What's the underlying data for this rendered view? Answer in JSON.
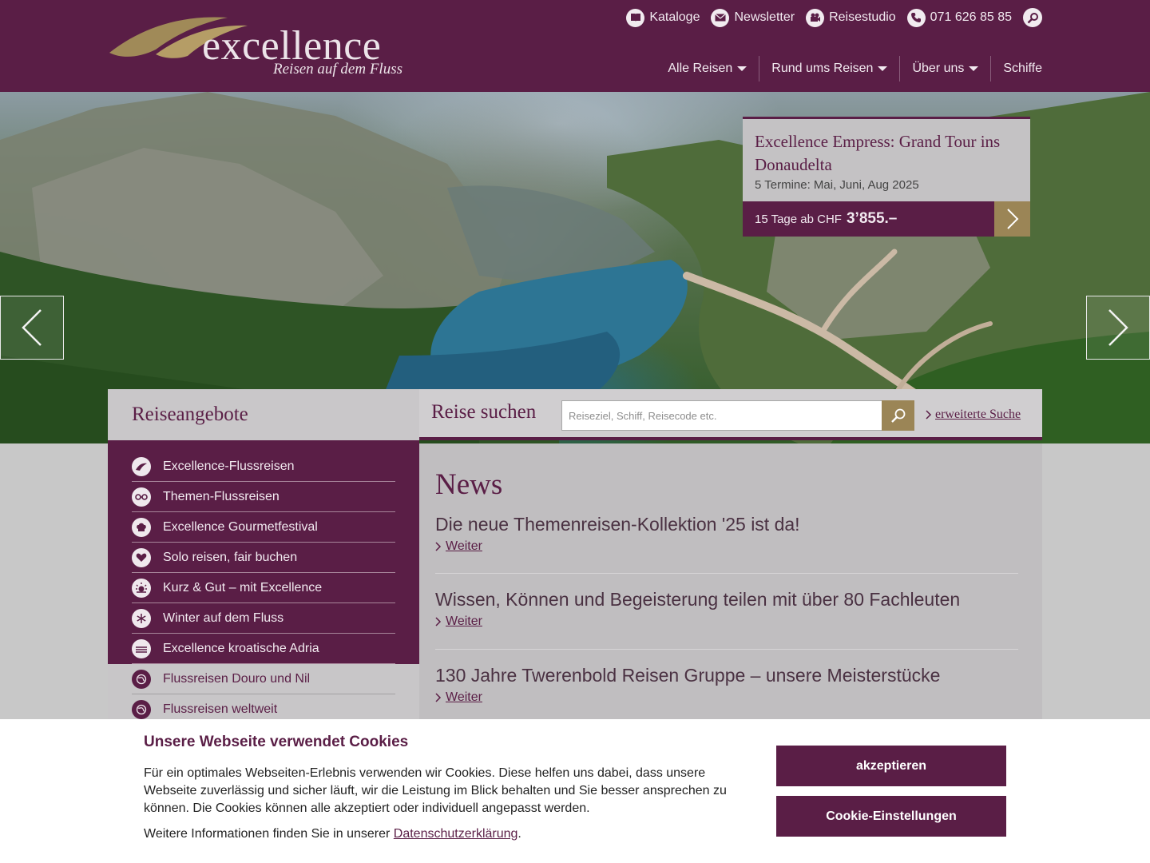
{
  "header": {
    "logo_word": "excellence",
    "logo_tagline": "Reisen auf dem Fluss",
    "topbar": [
      {
        "label": "Kataloge",
        "icon": "book-icon"
      },
      {
        "label": "Newsletter",
        "icon": "envelope-icon"
      },
      {
        "label": "Reisestudio",
        "icon": "camera-icon"
      },
      {
        "label": "071 626 85 85",
        "icon": "phone-icon"
      }
    ],
    "nav": [
      {
        "label": "Alle Reisen",
        "dropdown": true
      },
      {
        "label": "Rund ums Reisen",
        "dropdown": true
      },
      {
        "label": "Über uns",
        "dropdown": true
      },
      {
        "label": "Schiffe",
        "dropdown": false
      }
    ]
  },
  "hero": {
    "promo_title": "Excellence Empress: Grand Tour ins Donaudelta",
    "promo_dates": "5 Termine: Mai, Juni, Aug 2025",
    "promo_duration": "15 Tage ab CHF",
    "promo_price": "3’855.–"
  },
  "offers": {
    "title": "Reiseangebote",
    "items": [
      {
        "label": "Excellence-Flussreisen"
      },
      {
        "label": "Themen-Flussreisen"
      },
      {
        "label": "Excellence Gourmetfestival"
      },
      {
        "label": "Solo reisen, fair buchen"
      },
      {
        "label": "Kurz & Gut – mit Excellence"
      },
      {
        "label": "Winter auf dem Fluss"
      },
      {
        "label": "Excellence kroatische Adria"
      },
      {
        "label": "Flussreisen Douro und Nil"
      },
      {
        "label": "Flussreisen weltweit"
      }
    ]
  },
  "search": {
    "title": "Reise suchen",
    "placeholder": "Reiseziel, Schiff, Reisecode etc.",
    "extended_label": "erweiterte Suche"
  },
  "news": {
    "title": "News",
    "more_label": "Weiter",
    "items": [
      {
        "headline": "Die neue Themenreisen-Kollektion '25 ist da!"
      },
      {
        "headline": "Wissen, Können und Begeisterung teilen mit über 80 Fachleuten"
      },
      {
        "headline": "130 Jahre Twerenbold Reisen Gruppe – unsere Meisterstücke"
      }
    ]
  },
  "cookie": {
    "title": "Unsere Webseite verwendet Cookies",
    "text": "Für ein optimales Webseiten-Erlebnis verwenden wir Cookies. Diese helfen uns dabei, dass unsere Webseite zuverlässig und sicher läuft, wir die Leistung im Blick behalten und Sie besser ansprechen zu können. Die Cookies können alle akzeptiert oder individuell angepasst werden.",
    "more_prefix": "Weitere Informationen finden Sie in unserer",
    "more_link": "Datenschutzerklärung",
    "more_suffix": ".",
    "accept_label": "akzeptieren",
    "settings_label": "Cookie-Einstellungen"
  },
  "colors": {
    "brand": "#5a1e46",
    "gold": "#9b8556",
    "panel": "#c9c7c9"
  }
}
